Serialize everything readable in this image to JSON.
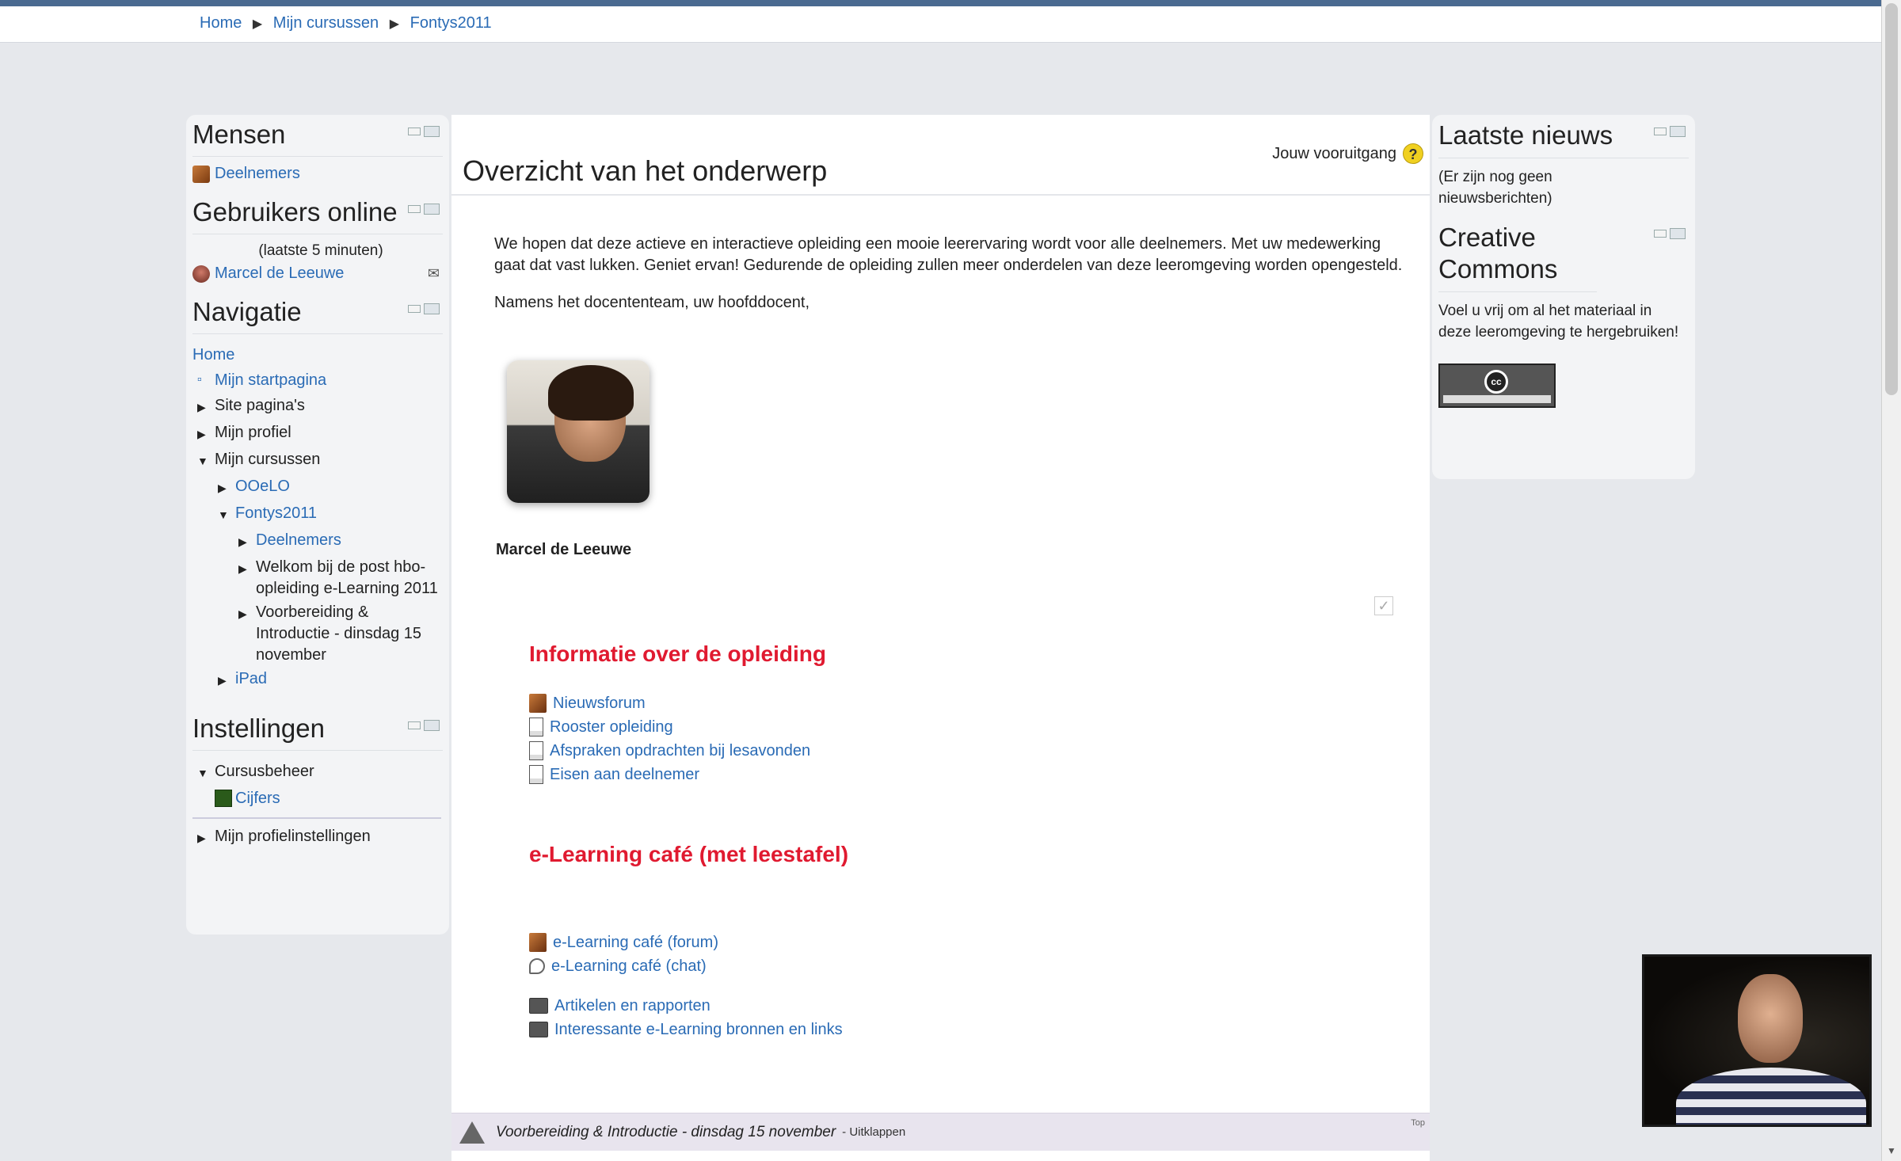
{
  "breadcrumb": {
    "items": [
      "Home",
      "Mijn cursussen",
      "Fontys2011"
    ],
    "separator": "▶"
  },
  "left": {
    "mensen": {
      "title": "Mensen",
      "participants": "Deelnemers"
    },
    "online": {
      "title": "Gebruikers online",
      "period": "(laatste 5 minuten)",
      "user": "Marcel de Leeuwe"
    },
    "navigatie": {
      "title": "Navigatie",
      "home": "Home",
      "startpagina": "Mijn startpagina",
      "site_pages": "Site pagina's",
      "profile": "Mijn profiel",
      "courses": "Mijn cursussen",
      "oolo": "OOeLO",
      "fontys": "Fontys2011",
      "deelnemers": "Deelnemers",
      "welkom": "Welkom bij de post hbo-opleiding e-Learning 2011",
      "voorbereiding": "Voorbereiding & Introductie - dinsdag 15 november",
      "ipad": "iPad"
    },
    "instellingen": {
      "title": "Instellingen",
      "cursusbeheer": "Cursusbeheer",
      "cijfers": "Cijfers",
      "profielinstellingen": "Mijn profielinstellingen"
    }
  },
  "main": {
    "title": "Overzicht van het onderwerp",
    "progress": "Jouw vooruitgang",
    "help": "?",
    "summary_p1": "We hopen dat deze actieve en interactieve opleiding een mooie leerervaring wordt voor alle deelnemers. Met uw medewerking gaat dat vast lukken. Geniet ervan! Gedurende de opleiding zullen meer onderdelen van deze leeromgeving worden opengesteld.",
    "summary_p2": "Namens het docententeam, uw hoofddocent,",
    "teacher_name": "Marcel de Leeuwe",
    "section1": {
      "heading": "Informatie over de opleiding",
      "items": [
        "Nieuwsforum",
        "Rooster opleiding",
        "Afspraken opdrachten bij lesavonden",
        "Eisen aan deelnemer"
      ]
    },
    "section2": {
      "heading": "e-Learning café (met leestafel)",
      "items": [
        "e-Learning café (forum)",
        "e-Learning café (chat)"
      ]
    },
    "section3": {
      "items": [
        "Artikelen en rapporten",
        "Interessante e-Learning bronnen en links"
      ]
    },
    "collapsed_section": {
      "title": "Voorbereiding & Introductie - dinsdag 15 november",
      "action": "- Uitklappen",
      "top": "Top"
    }
  },
  "right": {
    "news": {
      "title": "Laatste nieuws",
      "empty": "(Er zijn nog geen nieuwsberichten)"
    },
    "cc": {
      "title": "Creative Commons",
      "text": "Voel u vrij om al het materiaal in deze leeromgeving te hergebruiken!",
      "badge": "cc"
    }
  }
}
